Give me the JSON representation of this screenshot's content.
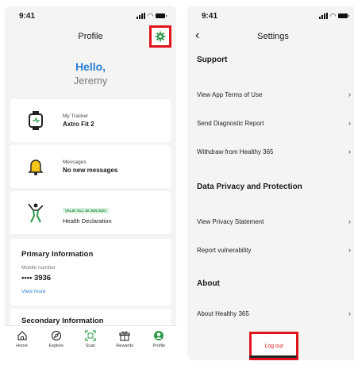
{
  "profile_screen": {
    "time": "9:41",
    "title": "Profile",
    "greeting": "Hello,",
    "user_name": "Jeremy",
    "tracker": {
      "label": "My Tracker",
      "value": "Axtro Fit 2"
    },
    "messages": {
      "label": "Messages",
      "value": "No new messages"
    },
    "health": {
      "badge": "VALID TILL 30 JUN 2021",
      "value": "Health Declaration"
    },
    "primary": {
      "title": "Primary Information",
      "label": "Mobile number",
      "value": "•••• 3936",
      "link": "View more"
    },
    "secondary": {
      "title": "Secondary Information"
    },
    "tabs": [
      {
        "label": "Home",
        "icon": "home-icon"
      },
      {
        "label": "Explore",
        "icon": "compass-icon"
      },
      {
        "label": "Scan",
        "icon": "scan-icon"
      },
      {
        "label": "Rewards",
        "icon": "gift-icon"
      },
      {
        "label": "Profile",
        "icon": "profile-icon"
      }
    ],
    "accent_color": "#2a7fd4",
    "highlight_color": "#e0141c"
  },
  "settings_screen": {
    "time": "9:41",
    "title": "Settings",
    "support": {
      "title": "Support",
      "items": [
        "View App Terms of Use",
        "Send Diagnostic Report",
        "Withdraw from Healthy 365"
      ]
    },
    "privacy": {
      "title": "Data Privacy and Protection",
      "items": [
        "View Privacy Statement",
        "Report vulnerability"
      ]
    },
    "about": {
      "title": "About",
      "items": [
        "About Healthy 365"
      ]
    },
    "logout_label": "Log out"
  }
}
